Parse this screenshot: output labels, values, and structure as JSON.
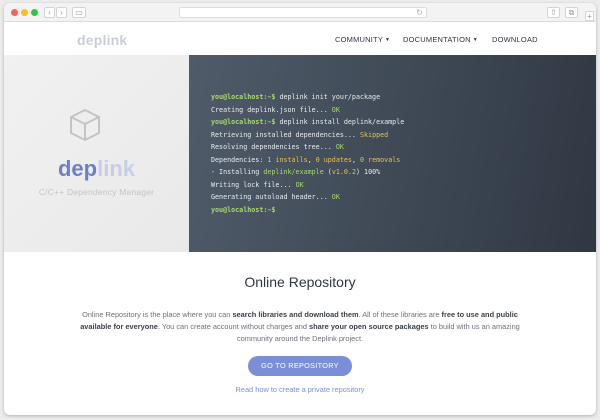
{
  "browser": {
    "nav_back_glyph": "‹",
    "nav_forward_glyph": "›",
    "sidebar_glyph": "▭",
    "reload_glyph": "↻",
    "share_glyph": "⇧",
    "tabs_glyph": "⧉",
    "new_tab_glyph": "+"
  },
  "nav": {
    "logo": "deplink",
    "menu": [
      {
        "label": "COMMUNITY",
        "caret": "▼"
      },
      {
        "label": "DOCUMENTATION",
        "caret": "▼"
      },
      {
        "label": "DOWNLOAD",
        "caret": ""
      }
    ]
  },
  "hero": {
    "logo_dep": "dep",
    "logo_link": "link",
    "subtitle": "C/C++ Dependency Manager",
    "terminal": [
      [
        {
          "t": "you@localhost:~$",
          "c": "prompt"
        },
        {
          "t": " deplink init your/package",
          "c": ""
        }
      ],
      [
        {
          "t": "Creating deplink.json file... ",
          "c": ""
        },
        {
          "t": "OK",
          "c": "ok"
        }
      ],
      [
        {
          "t": "you@localhost:~$",
          "c": "prompt"
        },
        {
          "t": " deplink install deplink/example",
          "c": ""
        }
      ],
      [
        {
          "t": "Retrieving installed dependencies... ",
          "c": ""
        },
        {
          "t": "Skipped",
          "c": "warn"
        }
      ],
      [
        {
          "t": "Resolving dependencies tree... ",
          "c": ""
        },
        {
          "t": "OK",
          "c": "ok"
        }
      ],
      [
        {
          "t": "Dependencies: ",
          "c": ""
        },
        {
          "t": "1 installs",
          "c": "num"
        },
        {
          "t": ", ",
          "c": ""
        },
        {
          "t": "0 updates",
          "c": "num"
        },
        {
          "t": ", ",
          "c": ""
        },
        {
          "t": "0 removals",
          "c": "num"
        }
      ],
      [
        {
          "t": "- Installing ",
          "c": ""
        },
        {
          "t": "deplink/example",
          "c": "green"
        },
        {
          "t": " (",
          "c": ""
        },
        {
          "t": "v1.0.2",
          "c": "num"
        },
        {
          "t": ") 100%",
          "c": ""
        }
      ],
      [
        {
          "t": "Writing lock file... ",
          "c": ""
        },
        {
          "t": "OK",
          "c": "ok"
        }
      ],
      [
        {
          "t": "Generating autoload header... ",
          "c": ""
        },
        {
          "t": "OK",
          "c": "ok"
        }
      ],
      [
        {
          "t": "you@localhost:~$",
          "c": "prompt"
        }
      ]
    ]
  },
  "content": {
    "title": "Online Repository",
    "description": [
      {
        "t": "Online Repository is the place where you can ",
        "b": false
      },
      {
        "t": "search libraries and download them",
        "b": true
      },
      {
        "t": ". All of these libraries are ",
        "b": false
      },
      {
        "t": "free to use and public available for everyone",
        "b": true
      },
      {
        "t": ". You can create account without charges and ",
        "b": false
      },
      {
        "t": "share your open source packages",
        "b": true
      },
      {
        "t": " to build with us an amazing community around the Deplink project.",
        "b": false
      }
    ],
    "cta_label": "GO TO REPOSITORY",
    "link_label": "Read how to create a private repository"
  },
  "colors": {
    "accent": "#7b8ed8",
    "prompt": "#a8d96e",
    "warning": "#e6c14a"
  }
}
